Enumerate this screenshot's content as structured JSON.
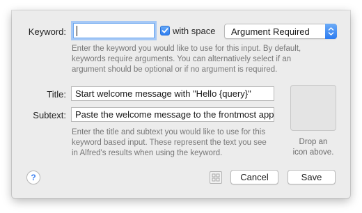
{
  "keyword": {
    "label": "Keyword:",
    "value": "",
    "with_space_label": "with space",
    "with_space_checked": true,
    "argument_select": "Argument Required",
    "help_lines": [
      "Enter the keyword you would like to use for this input. By default,",
      "keywords require arguments. You can alternatively select if an",
      "argument should be optional or if no argument is required."
    ]
  },
  "title": {
    "label": "Title:",
    "value": "Start welcome message with \"Hello {query}\""
  },
  "subtext": {
    "label": "Subtext:",
    "value": "Paste the welcome message to the frontmost app"
  },
  "text_help_lines": [
    "Enter the title and subtext you would like to use for this",
    "keyword based input. These represent the text you see",
    "in Alfred's results when using the keyword."
  ],
  "icon_drop": {
    "lines": [
      "Drop an",
      "icon above."
    ]
  },
  "footer": {
    "help_glyph": "?",
    "cancel_label": "Cancel",
    "save_label": "Save"
  },
  "colors": {
    "accent": "#3b7ff0",
    "focus_ring": "#a5c8f6",
    "sheet_background": "#ececec"
  },
  "icons": {
    "help": "question-mark-icon",
    "checkbox": "checkmark-icon",
    "select": "up-down-chevron-icon",
    "layout": "grid-layout-icon"
  }
}
